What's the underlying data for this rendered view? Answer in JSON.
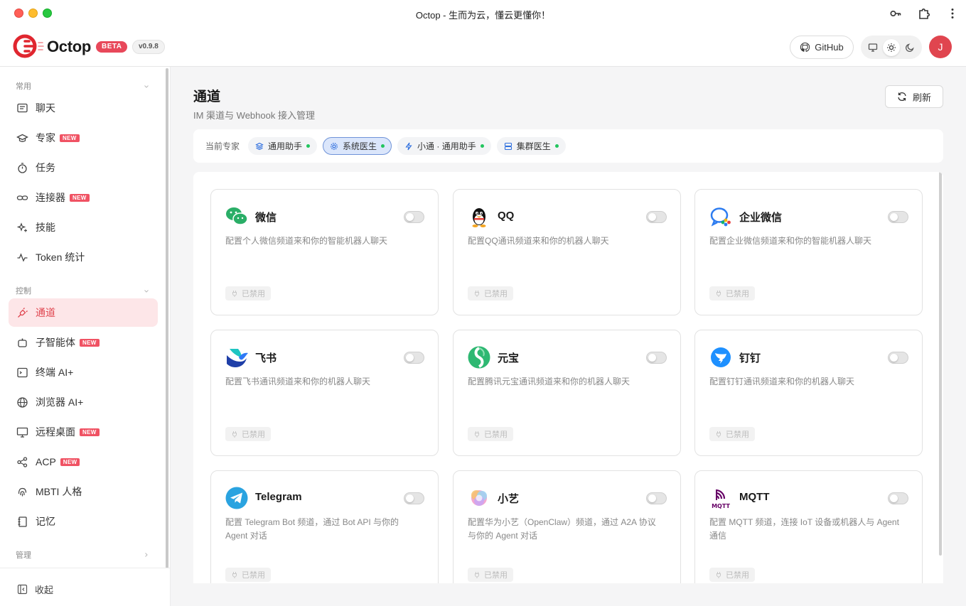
{
  "window": {
    "title": "Octop - 生而为云，懂云更懂你！"
  },
  "brand": {
    "name": "Octop",
    "badge": "BETA",
    "version": "v0.9.8"
  },
  "header": {
    "github_label": "GitHub",
    "avatar_letter": "J",
    "theme_active": "light"
  },
  "sidebar": {
    "sections": [
      {
        "label": "常用"
      },
      {
        "label": "控制"
      },
      {
        "label": "管理"
      }
    ],
    "items": [
      {
        "label": "聊天",
        "icon": "chat-icon",
        "new": false
      },
      {
        "label": "专家",
        "icon": "graduation-cap-icon",
        "new": true
      },
      {
        "label": "任务",
        "icon": "stopwatch-icon",
        "new": false
      },
      {
        "label": "连接器",
        "icon": "link-icon",
        "new": true
      },
      {
        "label": "技能",
        "icon": "sparkles-icon",
        "new": false
      },
      {
        "label": "Token 统计",
        "icon": "activity-icon",
        "new": false
      },
      {
        "label": "通道",
        "icon": "plug-icon",
        "new": false,
        "active": true
      },
      {
        "label": "子智能体",
        "icon": "bot-icon",
        "new": true
      },
      {
        "label": "终端 AI+",
        "icon": "terminal-icon",
        "new": false
      },
      {
        "label": "浏览器 AI+",
        "icon": "globe-icon",
        "new": false
      },
      {
        "label": "远程桌面",
        "icon": "monitor-icon",
        "new": true
      },
      {
        "label": "ACP",
        "icon": "share-icon",
        "new": true
      },
      {
        "label": "MBTI 人格",
        "icon": "fingerprint-icon",
        "new": false
      },
      {
        "label": "记忆",
        "icon": "notebook-icon",
        "new": false
      }
    ],
    "new_badge": "NEW",
    "collapse_label": "收起"
  },
  "main": {
    "title": "通道",
    "subtitle": "IM 渠道与 Webhook 接入管理",
    "refresh_label": "刷新",
    "expert_label": "当前专家",
    "experts": [
      {
        "name": "通用助手",
        "icon": "layers-icon",
        "selected": false
      },
      {
        "name": "系统医生",
        "icon": "cog-icon",
        "selected": true
      },
      {
        "name": "小通 · 通用助手",
        "icon": "zap-icon",
        "selected": false
      },
      {
        "name": "集群医生",
        "icon": "server-icon",
        "selected": false
      }
    ],
    "status_disabled": "已禁用",
    "channels": [
      {
        "name": "微信",
        "icon": "wechat-icon",
        "desc": "配置个人微信频道来和你的智能机器人聊天",
        "enabled": false
      },
      {
        "name": "QQ",
        "icon": "qq-icon",
        "desc": "配置QQ通讯频道来和你的机器人聊天",
        "enabled": false
      },
      {
        "name": "企业微信",
        "icon": "wecom-icon",
        "desc": "配置企业微信频道来和你的智能机器人聊天",
        "enabled": false
      },
      {
        "name": "飞书",
        "icon": "feishu-icon",
        "desc": "配置飞书通讯频道来和你的机器人聊天",
        "enabled": false
      },
      {
        "name": "元宝",
        "icon": "yuanbao-icon",
        "desc": "配置腾讯元宝通讯频道来和你的机器人聊天",
        "enabled": false
      },
      {
        "name": "钉钉",
        "icon": "dingtalk-icon",
        "desc": "配置钉钉通讯频道来和你的机器人聊天",
        "enabled": false
      },
      {
        "name": "Telegram",
        "icon": "telegram-icon",
        "desc": "配置 Telegram Bot 频道，通过 Bot API 与你的 Agent 对话",
        "enabled": false
      },
      {
        "name": "小艺",
        "icon": "xiaoyi-icon",
        "desc": "配置华为小艺（OpenClaw）频道，通过 A2A 协议与你的 Agent 对话",
        "enabled": false
      },
      {
        "name": "MQTT",
        "icon": "mqtt-icon",
        "desc": "配置 MQTT 频道，连接 IoT 设备或机器人与 Agent 通信",
        "enabled": false
      }
    ]
  },
  "colors": {
    "accent": "#e0454f",
    "active_bg": "#fde6e8",
    "badge": "#f05263",
    "chip_selected": "#dbe6fb"
  }
}
